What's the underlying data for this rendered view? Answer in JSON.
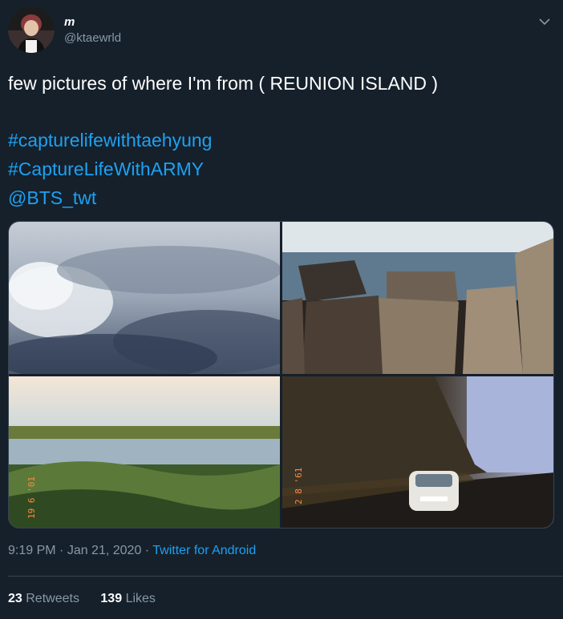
{
  "user": {
    "display_name": "m",
    "handle": "@ktaewrld"
  },
  "tweet": {
    "text_line1": "few pictures of where I'm from ( REUNION ISLAND )",
    "hashtag1": "#capturelifewithtaehyung",
    "hashtag2": "#CaptureLifeWithARMY",
    "mention": "@BTS_twt"
  },
  "media": {
    "photo3_stamp": "19 6 '01",
    "photo4_stamp": "2 8 '61"
  },
  "meta": {
    "time": "9:19 PM",
    "separator1": " · ",
    "date": "Jan 21, 2020",
    "separator2": " · ",
    "source": "Twitter for Android"
  },
  "stats": {
    "retweets_count": "23",
    "retweets_label": "Retweets",
    "likes_count": "139",
    "likes_label": "Likes"
  },
  "colors": {
    "background": "#15202b",
    "accent": "#1da1f2",
    "secondary_text": "#8899a6",
    "border": "#38444d"
  },
  "icons": {
    "caret": "chevron-down-icon"
  }
}
